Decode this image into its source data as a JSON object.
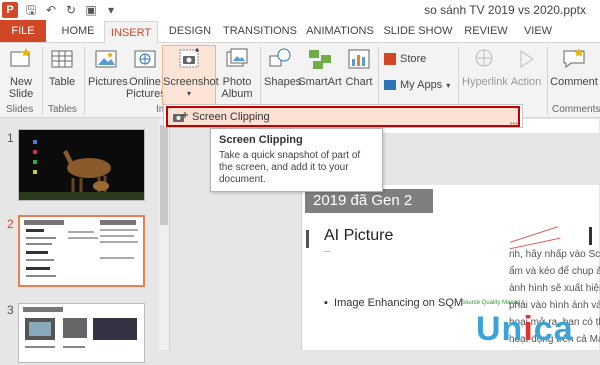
{
  "window": {
    "title": "so sánh TV 2019 vs 2020.pptx",
    "app_icon": "P"
  },
  "tabs": [
    {
      "label": "FILE"
    },
    {
      "label": "HOME"
    },
    {
      "label": "INSERT"
    },
    {
      "label": "DESIGN"
    },
    {
      "label": "TRANSITIONS"
    },
    {
      "label": "ANIMATIONS"
    },
    {
      "label": "SLIDE SHOW"
    },
    {
      "label": "REVIEW"
    },
    {
      "label": "VIEW"
    }
  ],
  "ribbon": {
    "new_slide": "New",
    "new_slide2": "Slide",
    "table": "Table",
    "pictures": "Pictures",
    "online_pictures": "Online",
    "online_pictures2": "Pictures",
    "screenshot": "Screenshot",
    "photo_album": "Photo",
    "photo_album2": "Album",
    "shapes": "Shapes",
    "smartart": "SmartArt",
    "chart": "Chart",
    "store": "Store",
    "my_apps": "My Apps",
    "hyperlink": "Hyperlink",
    "action": "Action",
    "comment": "Comment",
    "groups": {
      "slides": "Slides",
      "tables": "Tables",
      "images": "Im",
      "comments": "Comments"
    }
  },
  "dropdown": {
    "item": "Screen Clipping",
    "shortcut_letter": "C"
  },
  "tooltip": {
    "title": "Screen Clipping",
    "body": "Take a quick snapshot of part of the screen, and add it to your document."
  },
  "thumbnails": [
    {
      "num": "1"
    },
    {
      "num": "2"
    },
    {
      "num": "3"
    }
  ],
  "slide": {
    "header": "2019 đã Gen 2",
    "title": "AI Picture",
    "subtitle": "—",
    "bullet": "Image Enhancing on SQM",
    "bullet_tag": "Source Quality Manag...",
    "side_lines": [
      "nh, hãy nhấp vào Scre",
      "ẩm và kéo để chụp ảnh",
      "ành hình sẽ xuất hiện tr",
      "phải vào hình ảnh và c",
      "hoại mở ra, ban có thể",
      "hoạt động trên cả Mac"
    ]
  },
  "watermark": {
    "text1": "Un",
    "text2": "i",
    "text3": "ca"
  },
  "colors": {
    "accent": "#d24726",
    "highlight": "#fbe0d3",
    "border_red": "#c00000"
  }
}
